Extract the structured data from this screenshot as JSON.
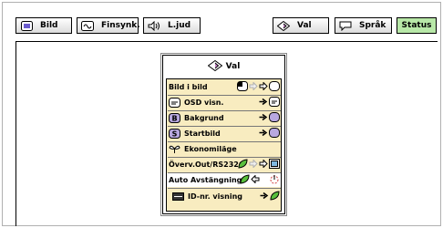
{
  "tabs": [
    {
      "label": "Bild",
      "icon": "picture-icon"
    },
    {
      "label": "Finsynk.",
      "icon": "fine-sync-icon"
    },
    {
      "label": "L.jud",
      "icon": "speaker-icon"
    },
    {
      "label": "Val",
      "icon": "options-icon"
    },
    {
      "label": "Språk",
      "icon": "speech-bubble-icon"
    },
    {
      "label": "Status",
      "icon": ""
    }
  ],
  "menu": {
    "title": "Val",
    "items": [
      {
        "label": "Bild i bild"
      },
      {
        "label": "OSD visn."
      },
      {
        "label": "Bakgrund"
      },
      {
        "label": "Startbild"
      },
      {
        "label": "Ekonomiläge"
      },
      {
        "label": "Överv.Out/RS232C"
      },
      {
        "label": "Auto Avstängning"
      },
      {
        "label": "ID-nr. visning"
      }
    ]
  },
  "colors": {
    "menu_bg": "#f8ecc0",
    "selection": "#ffffff",
    "eco_green": "#59c03c",
    "toggle_purple": "#b8a8e0",
    "status_tab": "#b8e8a8"
  }
}
